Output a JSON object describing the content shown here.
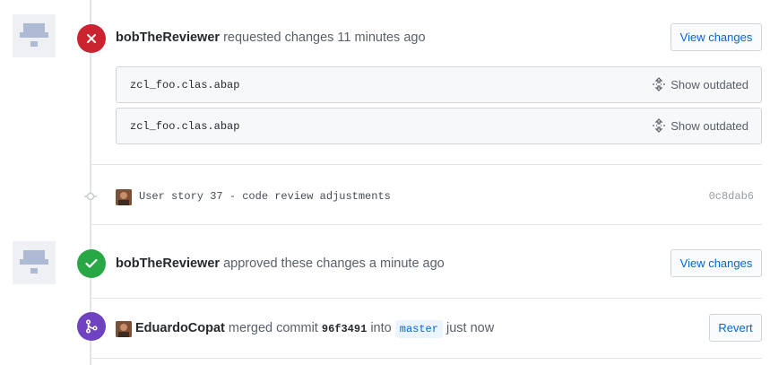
{
  "review1": {
    "author": "bobTheReviewer",
    "action": "requested changes 11 minutes ago",
    "button": "View changes",
    "files": [
      {
        "name": "zcl_foo.clas.abap",
        "action": "Show outdated"
      },
      {
        "name": "zcl_foo.clas.abap",
        "action": "Show outdated"
      }
    ],
    "badge_color": "#cb2431"
  },
  "commit": {
    "message": "User story 37 - code review adjustments",
    "sha": "0c8dab6"
  },
  "review2": {
    "author": "bobTheReviewer",
    "action": "approved these changes a minute ago",
    "button": "View changes",
    "badge_color": "#28a745"
  },
  "merge": {
    "author": "EduardoCopat",
    "text_before": "merged commit",
    "sha": "96f3491",
    "text_into": "into",
    "branch": "master",
    "time": "just now",
    "button": "Revert",
    "badge_color": "#6f42c1"
  }
}
